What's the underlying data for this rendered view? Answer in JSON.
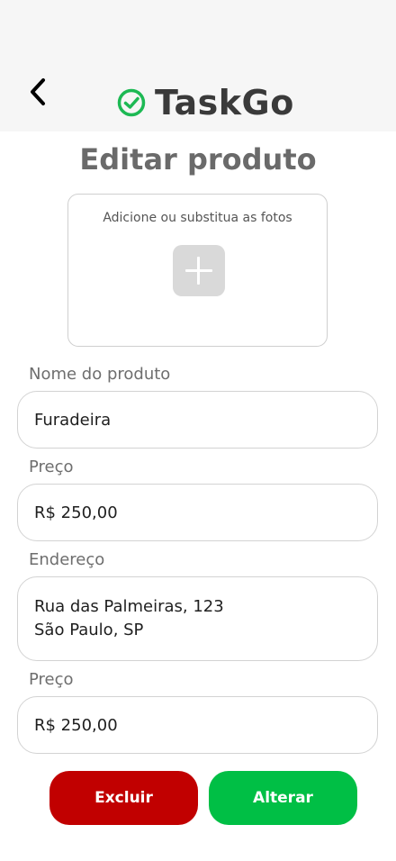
{
  "header": {
    "back_icon": "chevron-left-icon",
    "brand_icon": "check-circle-icon",
    "brand_name": "TaskGo",
    "brand_color": "#1db954"
  },
  "page": {
    "title": "Editar produto"
  },
  "photos": {
    "caption": "Adicione ou substitua as fotos",
    "add_icon": "plus-icon"
  },
  "fields": {
    "name": {
      "label": "Nome do produto",
      "value": "Furadeira"
    },
    "price": {
      "label": "Preço",
      "value": "R$ 250,00"
    },
    "address": {
      "label": "Endereço",
      "line1": "Rua das Palmeiras, 123",
      "line2": "São Paulo, SP"
    },
    "price2": {
      "label": "Preço",
      "value": "R$ 250,00"
    }
  },
  "actions": {
    "delete_label": "Excluir",
    "update_label": "Alterar",
    "delete_color": "#c10000",
    "update_color": "#00bf45"
  }
}
